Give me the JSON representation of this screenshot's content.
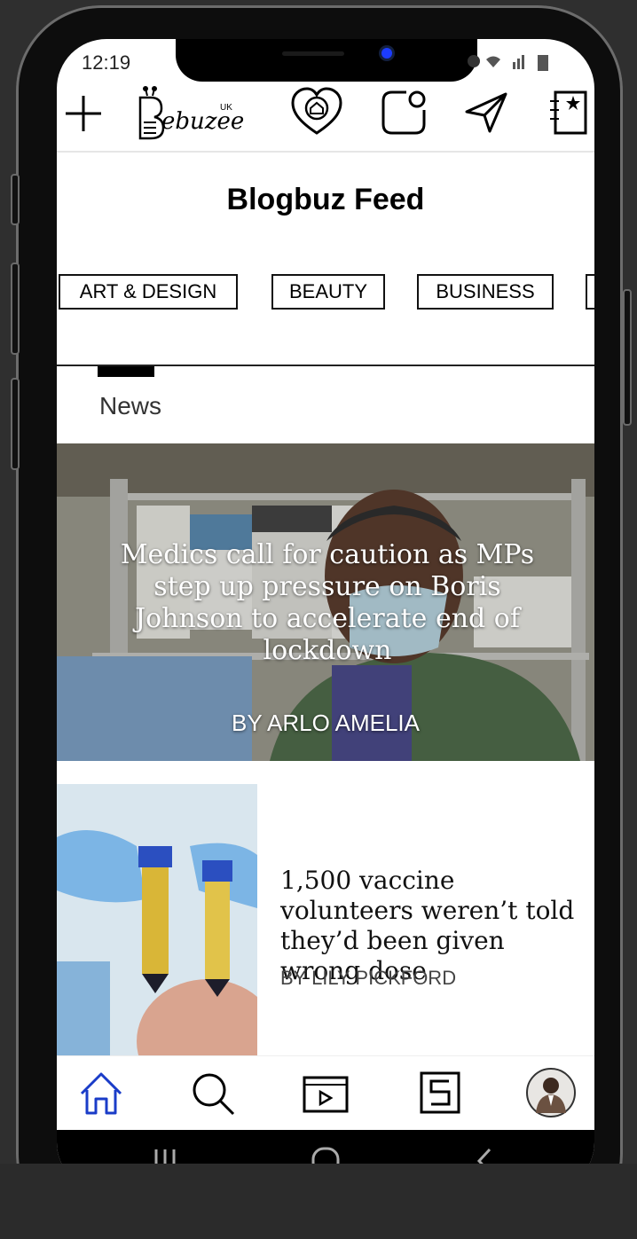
{
  "status_bar": {
    "time": "12:19"
  },
  "app": {
    "logo_text": "ebuzee",
    "logo_region": "UK"
  },
  "feed": {
    "title": "Blogbuz Feed"
  },
  "categories": [
    "ART & DESIGN",
    "BEAUTY",
    "BUSINESS"
  ],
  "section": {
    "label": "News"
  },
  "hero_article": {
    "title": "Medics call for caution as MPs step up pressure on Boris Johnson to accelerate end of lockdown",
    "author": "BY ARLO AMELIA"
  },
  "story": {
    "title": "1,500 vaccine volunteers weren’t told they’d been given wrong dose",
    "author": "BY LILY PICKFORD"
  },
  "icons": {
    "top_bar": [
      "plus-icon",
      "heart-home-icon",
      "new-post-icon",
      "send-icon",
      "bookmark-star-icon"
    ],
    "bottom_nav": [
      "home-icon",
      "search-icon",
      "video-icon",
      "stories-icon",
      "profile-avatar"
    ],
    "system_nav": [
      "recent-apps-icon",
      "home-circle-icon",
      "back-icon"
    ]
  },
  "colors": {
    "active_nav": "#1a3cc8",
    "text": "#111111",
    "background": "#ffffff"
  }
}
